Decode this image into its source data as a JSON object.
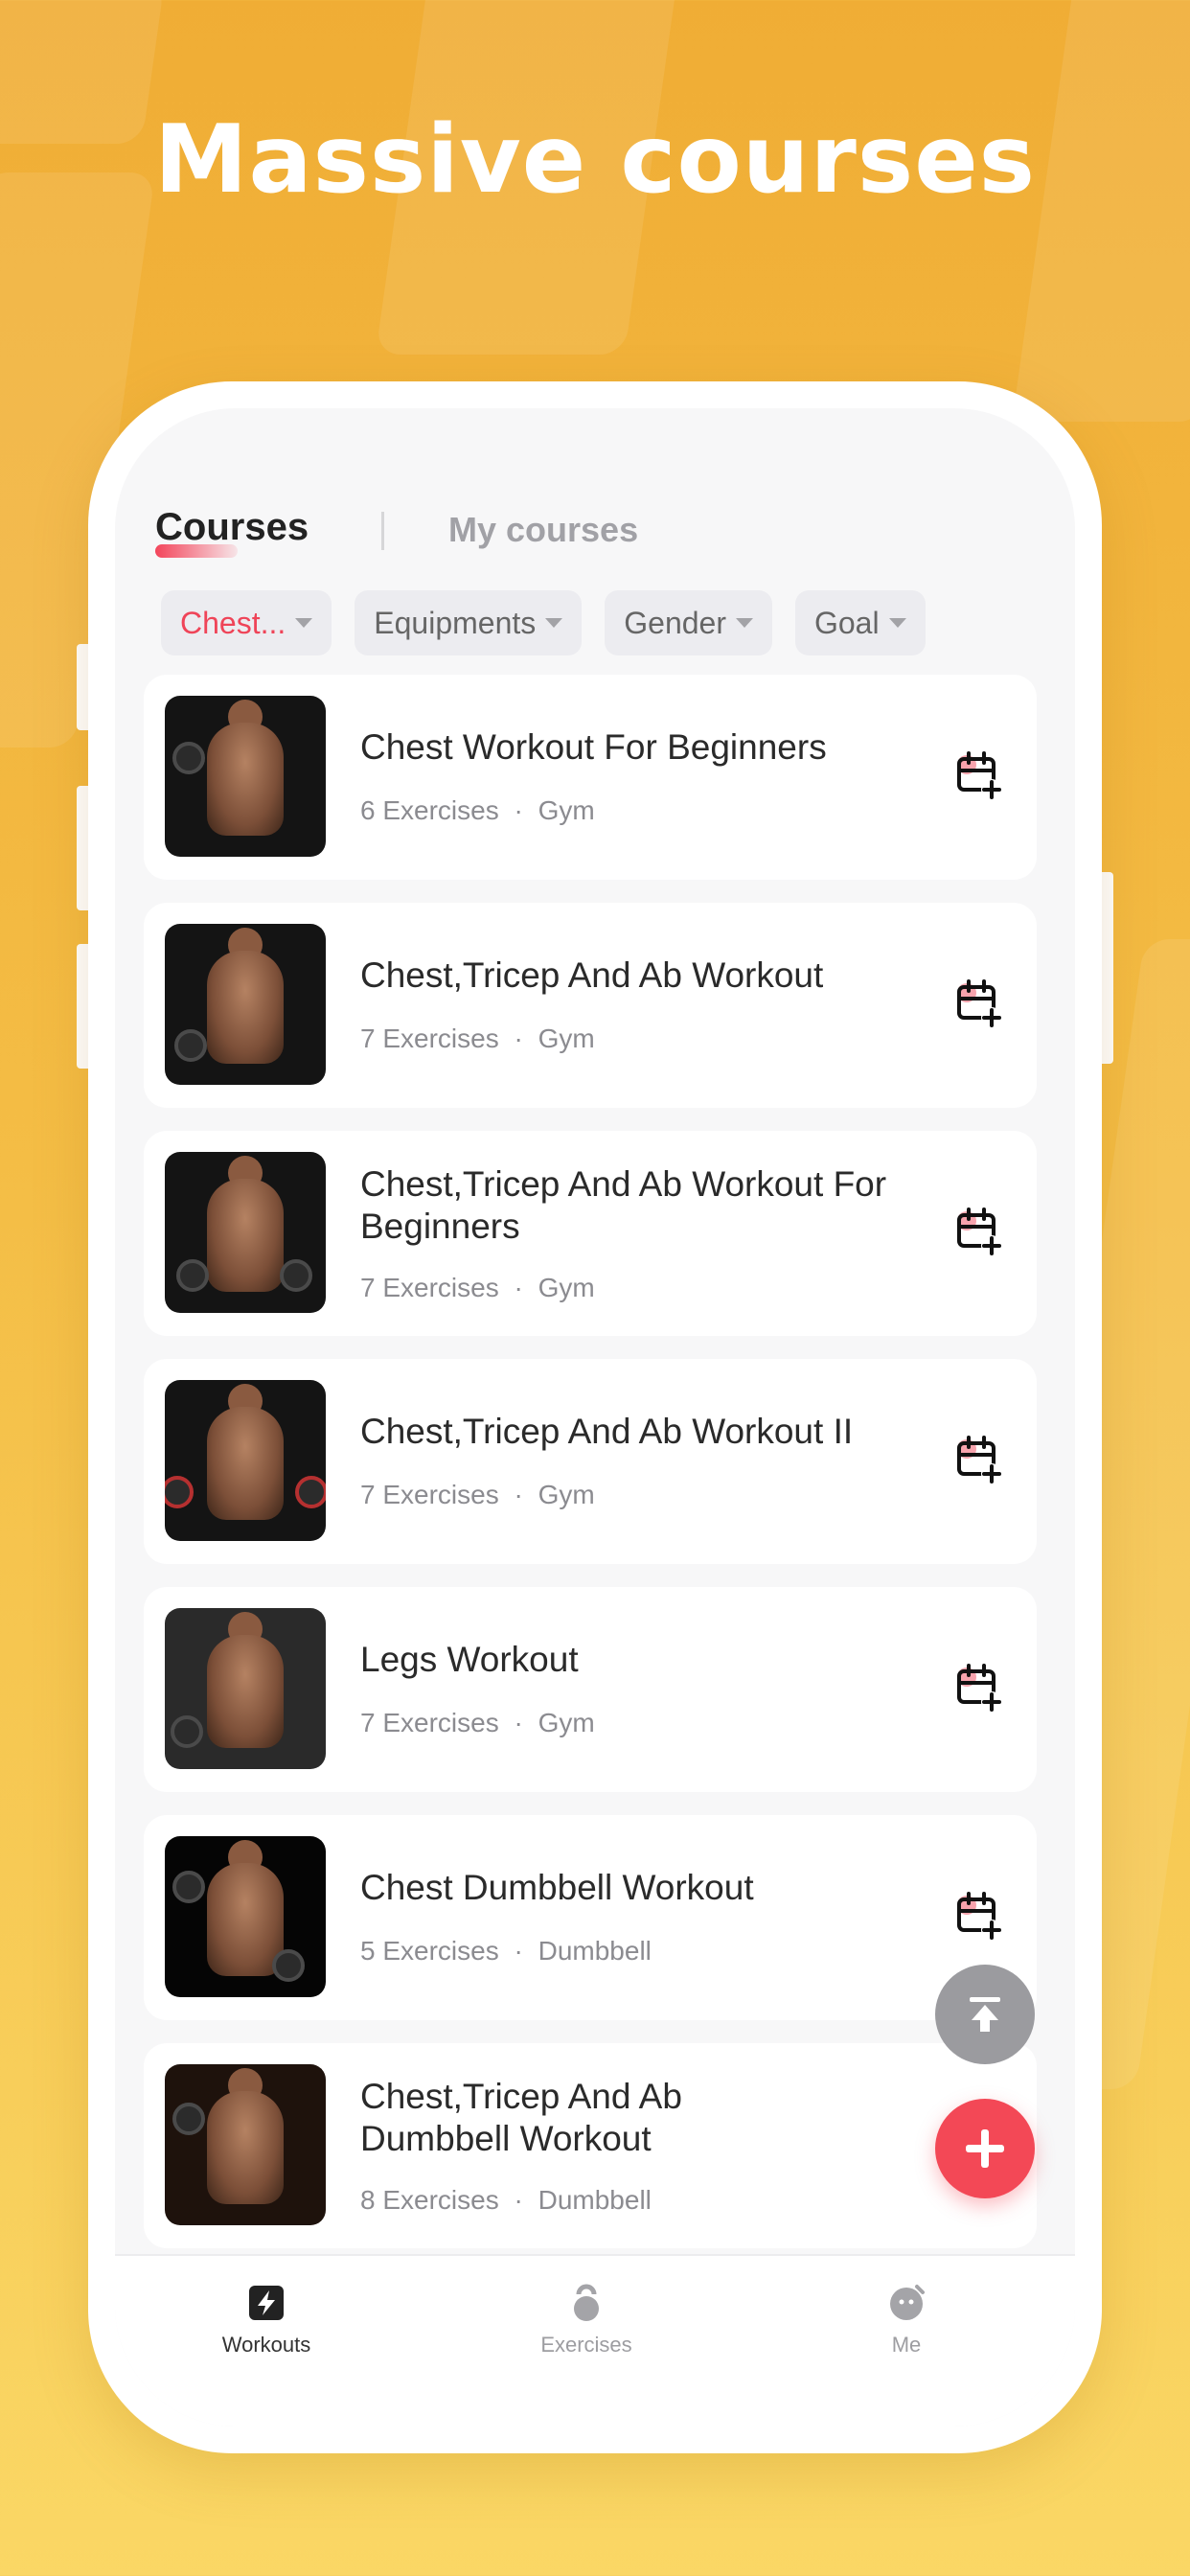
{
  "headline": "Massive courses",
  "tabs": {
    "courses": "Courses",
    "my_courses": "My courses"
  },
  "filters": [
    {
      "label": "Chest...",
      "active": true
    },
    {
      "label": "Equipments",
      "active": false
    },
    {
      "label": "Gender",
      "active": false
    },
    {
      "label": "Goal",
      "active": false
    }
  ],
  "workouts": [
    {
      "title": "Chest Workout For Beginners",
      "exercises": "6 Exercises",
      "equipment": "Gym"
    },
    {
      "title": "Chest,Tricep And Ab Workout",
      "exercises": "7 Exercises",
      "equipment": "Gym"
    },
    {
      "title": "Chest,Tricep And Ab Workout For Beginners",
      "exercises": "7 Exercises",
      "equipment": "Gym"
    },
    {
      "title": "Chest,Tricep And Ab Workout II",
      "exercises": "7 Exercises",
      "equipment": "Gym"
    },
    {
      "title": "Legs Workout",
      "exercises": "7 Exercises",
      "equipment": "Gym"
    },
    {
      "title": "Chest Dumbbell Workout",
      "exercises": "5 Exercises",
      "equipment": "Dumbbell"
    },
    {
      "title": "Chest,Tricep And Ab Dumbbell Workout",
      "exercises": "8 Exercises",
      "equipment": "Dumbbell"
    }
  ],
  "meta_separator": "·",
  "nav": {
    "workouts": "Workouts",
    "exercises": "Exercises",
    "me": "Me"
  },
  "colors": {
    "accent": "#f34856",
    "background_top": "#f0ad35",
    "background_bottom": "#fad765"
  },
  "icons": [
    "calendar-add-icon",
    "scroll-to-top-icon",
    "plus-icon",
    "lightning-icon",
    "kettlebell-icon",
    "profile-icon",
    "caret-down-icon"
  ]
}
